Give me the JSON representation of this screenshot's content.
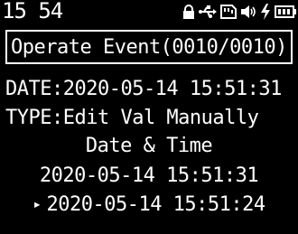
{
  "status_bar": {
    "time": "15 54",
    "icons": [
      "lock-icon",
      "usb-icon",
      "sd-card-icon",
      "speaker-icon",
      "charging-icon",
      "battery-icon"
    ]
  },
  "title": "Operate Event(0010/0010)",
  "details": {
    "date_line": "DATE:2020-05-14 15:51:31",
    "type_line": "TYPE:Edit Val Manually",
    "section_heading": "Date & Time",
    "value_from": "2020-05-14 15:51:31",
    "value_to": "2020-05-14 15:51:24",
    "selection_marker": "▸"
  }
}
